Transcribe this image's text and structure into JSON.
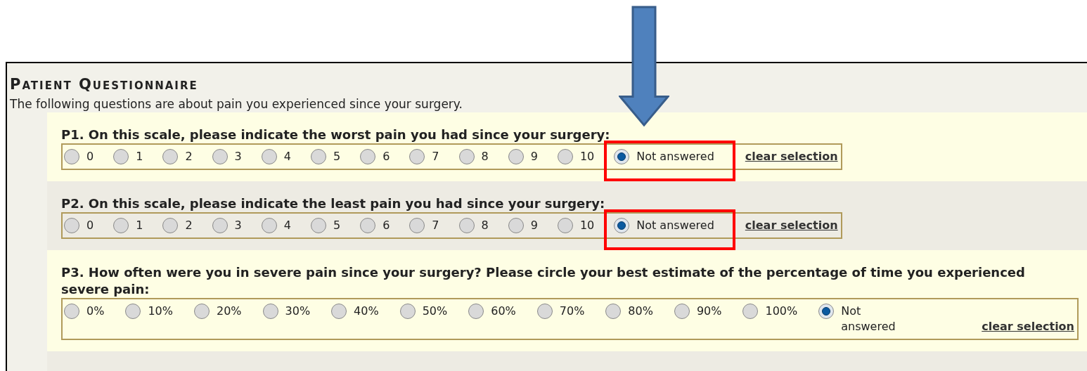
{
  "title": "Patient Questionnaire",
  "intro": "The following questions are about pain you experienced since your surgery.",
  "questions": [
    {
      "text": "P1. On this scale, please indicate the worst pain you had since your surgery:",
      "highlighted": true,
      "clear_link": "clear selection",
      "options": [
        {
          "label": "0",
          "selected": false
        },
        {
          "label": "1",
          "selected": false
        },
        {
          "label": "2",
          "selected": false
        },
        {
          "label": "3",
          "selected": false
        },
        {
          "label": "4",
          "selected": false
        },
        {
          "label": "5",
          "selected": false
        },
        {
          "label": "6",
          "selected": false
        },
        {
          "label": "7",
          "selected": false
        },
        {
          "label": "8",
          "selected": false
        },
        {
          "label": "9",
          "selected": false
        },
        {
          "label": "10",
          "selected": false
        },
        {
          "label": "Not answered",
          "selected": true
        }
      ]
    },
    {
      "text": "P2. On this scale, please indicate the least pain you had since your surgery:",
      "highlighted": true,
      "clear_link": "clear selection",
      "options": [
        {
          "label": "0",
          "selected": false
        },
        {
          "label": "1",
          "selected": false
        },
        {
          "label": "2",
          "selected": false
        },
        {
          "label": "3",
          "selected": false
        },
        {
          "label": "4",
          "selected": false
        },
        {
          "label": "5",
          "selected": false
        },
        {
          "label": "6",
          "selected": false
        },
        {
          "label": "7",
          "selected": false
        },
        {
          "label": "8",
          "selected": false
        },
        {
          "label": "9",
          "selected": false
        },
        {
          "label": "10",
          "selected": false
        },
        {
          "label": "Not answered",
          "selected": true
        }
      ]
    },
    {
      "text": "P3. How often were you in severe pain since your surgery? Please circle your best estimate of the percentage of time you experienced severe pain:",
      "highlighted": false,
      "clear_link": "clear selection",
      "options": [
        {
          "label": "0%",
          "selected": false
        },
        {
          "label": "10%",
          "selected": false
        },
        {
          "label": "20%",
          "selected": false
        },
        {
          "label": "30%",
          "selected": false
        },
        {
          "label": "40%",
          "selected": false
        },
        {
          "label": "50%",
          "selected": false
        },
        {
          "label": "60%",
          "selected": false
        },
        {
          "label": "70%",
          "selected": false
        },
        {
          "label": "80%",
          "selected": false
        },
        {
          "label": "90%",
          "selected": false
        },
        {
          "label": "100%",
          "selected": false
        },
        {
          "label": "Not answered",
          "selected": true
        }
      ]
    }
  ]
}
